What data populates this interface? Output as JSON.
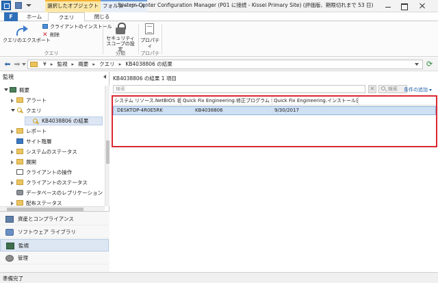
{
  "window": {
    "context_tab_selected": "選択したオブジェクト",
    "context_tab_folder": "フォルダー ツール",
    "title": "System Center Configuration Manager (P01 に接続 - Kissei Primary Site) (評価版、期限切れまで 53 日)"
  },
  "ribbon": {
    "file_tab": "F",
    "tabs": {
      "home": "ホーム",
      "query": "クエリ",
      "close": "閉じる"
    },
    "export_label": "クエリのエクスポート",
    "install_client_label": "クライアントのインストール",
    "delete_label": "削除",
    "group_query": "クエリ",
    "security_scope_label_1": "セキュリティ",
    "security_scope_label_2": "スコープの設定",
    "group_classify": "分類",
    "properties_label": "プロパティ",
    "group_properties": "プロパティ"
  },
  "address": {
    "crumbs": [
      "¥",
      "監視",
      "概要",
      "クエリ",
      "KB4038806 の結果"
    ],
    "separator": "▸"
  },
  "sidebar": {
    "title": "監視",
    "tree": [
      {
        "label": "概要",
        "icon": "monitor",
        "expand": "open",
        "indent": 0
      },
      {
        "label": "アラート",
        "icon": "folder",
        "expand": "closed",
        "indent": 1
      },
      {
        "label": "クエリ",
        "icon": "query",
        "expand": "open",
        "indent": 1
      },
      {
        "label": "KB4038806 の結果",
        "icon": "query",
        "expand": "none",
        "indent": 2,
        "selected": true
      },
      {
        "label": "レポート",
        "icon": "folder",
        "expand": "closed",
        "indent": 1
      },
      {
        "label": "サイト階層",
        "icon": "site",
        "expand": "none",
        "indent": 1
      },
      {
        "label": "システムのステータス",
        "icon": "folder",
        "expand": "closed",
        "indent": 1
      },
      {
        "label": "展開",
        "icon": "folder",
        "expand": "closed",
        "indent": 1
      },
      {
        "label": "クライアントの操作",
        "icon": "ops",
        "expand": "none",
        "indent": 1
      },
      {
        "label": "クライアントのステータス",
        "icon": "folder",
        "expand": "closed",
        "indent": 1
      },
      {
        "label": "データベースのレプリケーション",
        "icon": "db",
        "expand": "none",
        "indent": 1
      },
      {
        "label": "配布ステータス",
        "icon": "folder",
        "expand": "closed",
        "indent": 1
      }
    ],
    "workspaces": [
      {
        "label": "資産とコンプライアンス",
        "icon": "assets"
      },
      {
        "label": "ソフトウェア ライブラリ",
        "icon": "software"
      },
      {
        "label": "監視",
        "icon": "monitoring",
        "active": true
      },
      {
        "label": "管理",
        "icon": "admin"
      }
    ]
  },
  "main": {
    "result_title": "KB4038806 の結果 1 項目",
    "search_placeholder": "検索",
    "clear_label": "✕",
    "search_button": "検索",
    "add_criteria": "条件の追加",
    "columns": [
      "システム リソース.NetBIOS 名",
      "Quick Fix Engineering.修正プログラム ID",
      "Quick Fix Engineering.インストール日時"
    ],
    "rows": [
      [
        "DESKTOP-4R0E5RK",
        "KB4038806",
        "9/30/2017"
      ]
    ]
  },
  "status": {
    "text": "準備完了"
  },
  "colors": {
    "highlight_border": "#d9262f",
    "selected_row": "#cfe0f3",
    "context_tab_selected": "#fbe7a7",
    "file_tab": "#2f6fb8"
  }
}
